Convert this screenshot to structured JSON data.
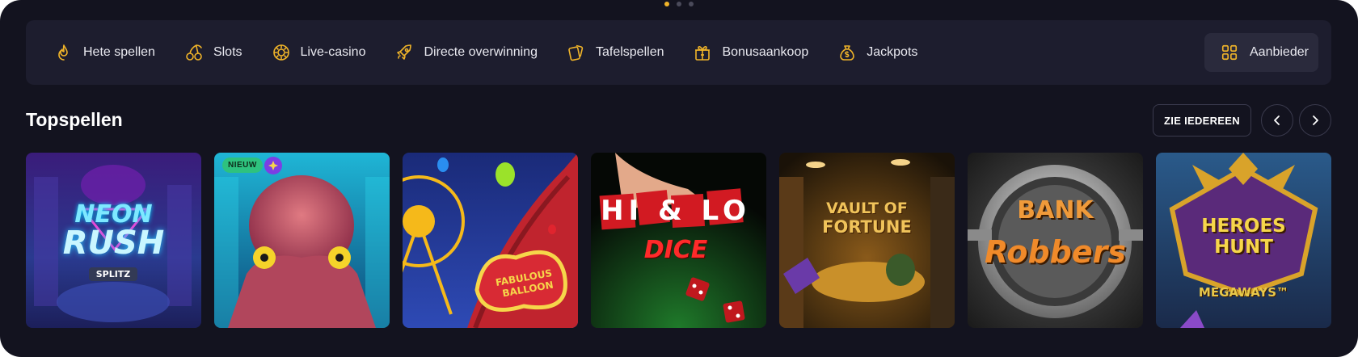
{
  "carousel": {
    "pages": 3,
    "active": 0
  },
  "nav": {
    "items": [
      {
        "label": "Hete spellen",
        "icon": "flame-icon"
      },
      {
        "label": "Slots",
        "icon": "cherries-icon"
      },
      {
        "label": "Live-casino",
        "icon": "casino-chip-icon"
      },
      {
        "label": "Directe overwinning",
        "icon": "rocket-icon"
      },
      {
        "label": "Tafelspellen",
        "icon": "cards-icon"
      },
      {
        "label": "Bonusaankoop",
        "icon": "gift-icon"
      },
      {
        "label": "Jackpots",
        "icon": "money-bag-icon"
      }
    ],
    "provider_label": "Aanbieder",
    "provider_icon": "grid-icon"
  },
  "section": {
    "title": "Topspellen",
    "see_all_label": "ZIE IEDEREEN"
  },
  "colors": {
    "accent": "#f0b429",
    "background": "#13131f",
    "panel": "#1d1d2e",
    "new_badge": "#2ec27e"
  },
  "games": [
    {
      "title_lines": [
        "NEON",
        "RUSH"
      ],
      "subtitle": "SPLITZ"
    },
    {
      "badge": "NIEUW"
    },
    {
      "title_lines": [
        "FABULOUS",
        "BALLOON"
      ]
    },
    {
      "title_lines": [
        "HI & LO",
        "DICE"
      ]
    },
    {
      "title_lines": [
        "VAULT OF",
        "FORTUNE"
      ]
    },
    {
      "title_lines": [
        "BANK",
        "Robbers"
      ]
    },
    {
      "title_lines": [
        "HEROES",
        "HUNT"
      ],
      "subtitle": "MEGAWAYS™"
    }
  ]
}
